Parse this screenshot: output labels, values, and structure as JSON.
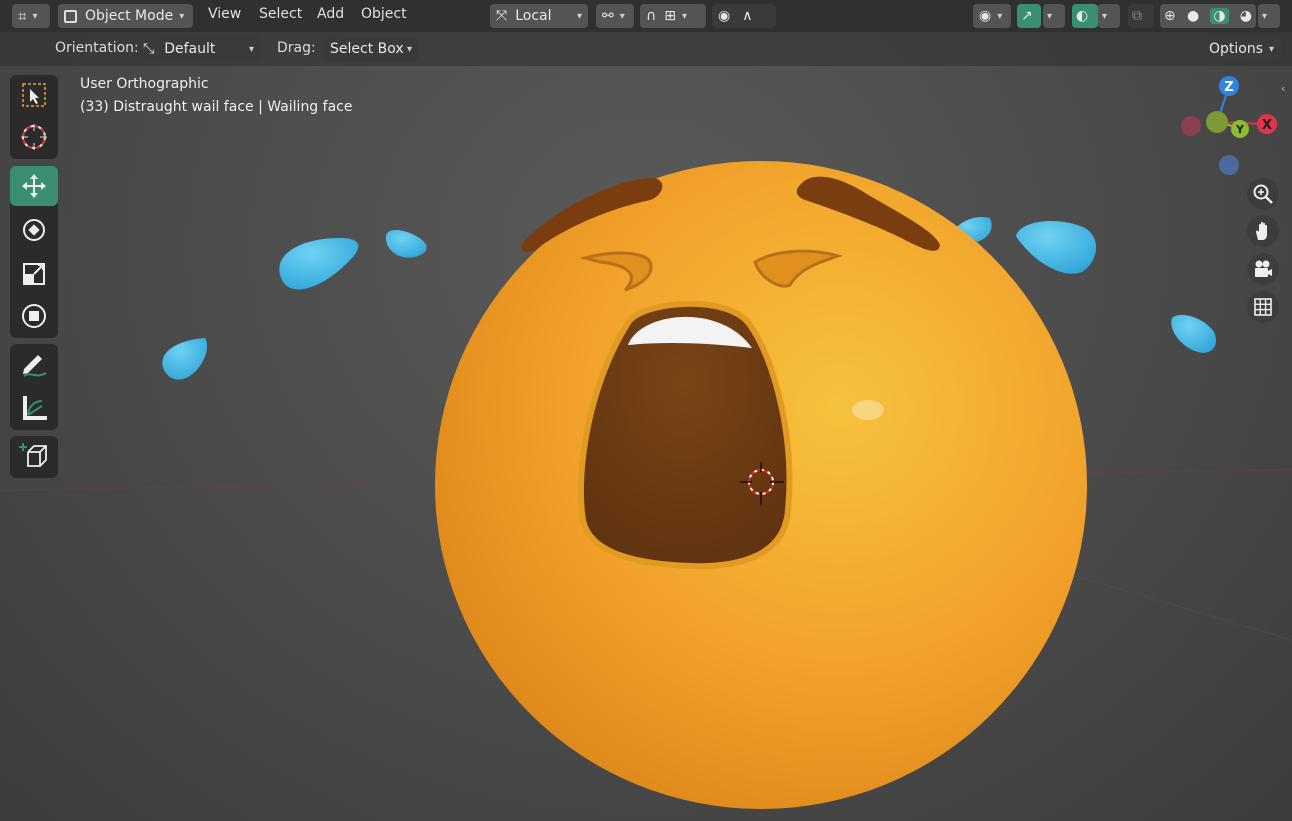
{
  "header": {
    "editor_type_icon": "viewport-icon",
    "mode": "Object Mode",
    "menus": [
      "View",
      "Select",
      "Add",
      "Object"
    ],
    "transform_orientation": "Local",
    "colors": {
      "accent": "#3a8f73",
      "header_bg": "#303030",
      "button_bg": "#545454"
    }
  },
  "tool_settings": {
    "orientation_label": "Orientation:",
    "orientation_value": "Default",
    "drag_label": "Drag:",
    "drag_value": "Select Box",
    "options_label": "Options"
  },
  "toolbar": {
    "tools": [
      "select-box",
      "cursor",
      "move",
      "rotate",
      "scale",
      "transform",
      "annotate",
      "measure",
      "add-cube"
    ],
    "active": "move"
  },
  "viewport": {
    "view_name": "User Orthographic",
    "object_info": "(33) Distraught wail face | Wailing face"
  },
  "gizmo": {
    "axes": [
      "Z",
      "Y",
      "X"
    ],
    "colors": {
      "x": "#e0344c",
      "y": "#8cba32",
      "z": "#2f84e0"
    }
  },
  "nav_buttons": [
    "zoom-icon",
    "hand-icon",
    "camera-icon",
    "grid-icon"
  ]
}
